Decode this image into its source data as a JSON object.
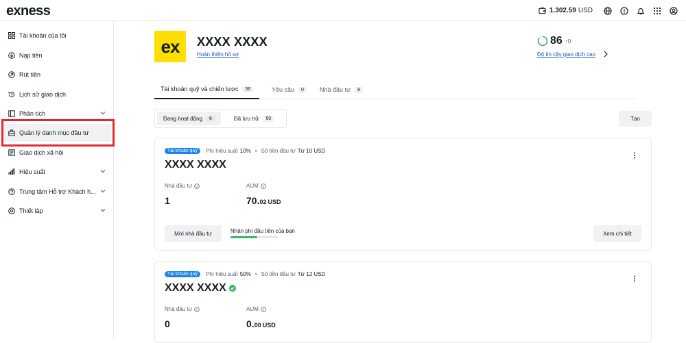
{
  "header": {
    "logo": "exness",
    "balance": "1.302.59",
    "currency": "USD"
  },
  "sidebar": {
    "items": [
      {
        "label": "Tài khoản của tôi",
        "icon": "grid-icon"
      },
      {
        "label": "Nạp tiền",
        "icon": "deposit-icon"
      },
      {
        "label": "Rút tiền",
        "icon": "withdraw-icon"
      },
      {
        "label": "Lịch sử giao dịch",
        "icon": "history-icon"
      },
      {
        "label": "Phân tích",
        "icon": "analytics-icon"
      },
      {
        "label": "Quản lý danh mục đầu tư",
        "icon": "portfolio-icon"
      },
      {
        "label": "Giao dịch xã hội",
        "icon": "social-trading-icon"
      },
      {
        "label": "Hiệu suất",
        "icon": "performance-icon"
      },
      {
        "label": "Trung tâm Hỗ trợ Khách h...",
        "icon": "help-icon"
      },
      {
        "label": "Thiết lập",
        "icon": "settings-icon"
      }
    ]
  },
  "profile": {
    "avatar_text": "ex",
    "name": "XXXX XXXX",
    "complete_link": "Hoàn thiện hồ sơ",
    "trust_score": "86",
    "trust_change": "↑0",
    "trust_link": "Độ tin cậy giao dịch cao"
  },
  "tabs": [
    {
      "label": "Tài khoản quỹ và chiến lược",
      "count": "56"
    },
    {
      "label": "Yêu cầu",
      "count": "0"
    },
    {
      "label": "Nhà đầu tư",
      "count": "8"
    }
  ],
  "filter": {
    "active_label": "Đang hoạt động",
    "active_count": "6",
    "archived_label": "Đã lưu trữ",
    "archived_count": "50",
    "create_button": "Tạo"
  },
  "cards": [
    {
      "badge": "Tài khoản quỹ",
      "fee_label": "Phí hiệu suất",
      "fee_value": "10%",
      "min_label": "Số tiền đầu tư",
      "min_value": "Từ 10 USD",
      "title": "XXXX XXXX",
      "investors_label": "Nhà đầu tư",
      "investors_value": "1",
      "aum_label": "AUM",
      "aum_int": "70.",
      "aum_dec": "02",
      "aum_cur": "USD",
      "invite_button": "Mời nhà đầu tư",
      "first_fee_text": "Nhận phí đầu tiên của bạn",
      "first_fee_progress": 0.55,
      "details_button": "Xem chi tiết"
    },
    {
      "badge": "Tài khoản quỹ",
      "fee_label": "Phí hiệu suất",
      "fee_value": "50%",
      "min_label": "Số tiền đầu tư",
      "min_value": "Từ 12 USD",
      "title": "XXXX XXXX",
      "investors_label": "Nhà đầu tư",
      "investors_value": "0",
      "aum_label": "AUM",
      "aum_int": "0.",
      "aum_dec": "00",
      "aum_cur": "USD"
    }
  ],
  "colors": {
    "brand_yellow": "#ffde02",
    "highlight_red": "#e8272c",
    "link_blue": "#1c58c6",
    "badge_blue": "#1c84e6",
    "progress_green": "#37b766"
  }
}
